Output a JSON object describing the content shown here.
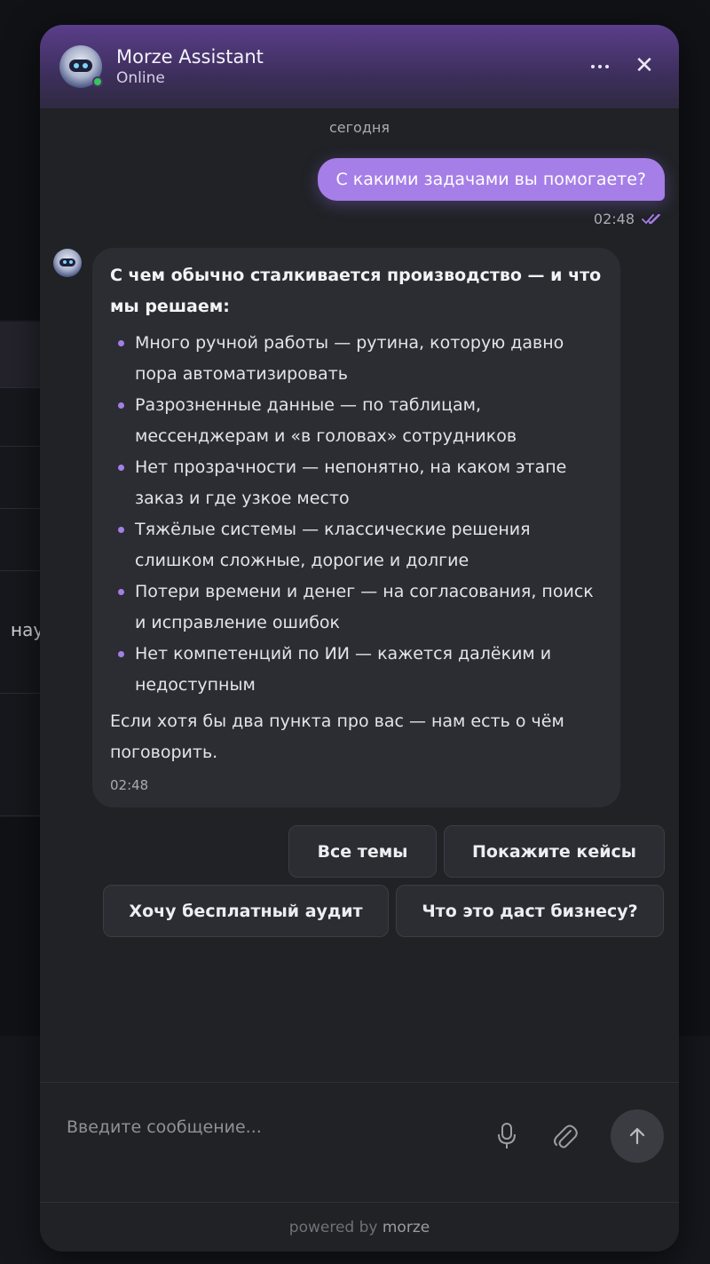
{
  "background": {
    "fragment_text": "нау"
  },
  "header": {
    "title": "Morze Assistant",
    "status": "Online",
    "more_icon": "more-horizontal-icon",
    "close_icon": "close-icon",
    "close_glyph": "✕"
  },
  "chat": {
    "date_separator": "сегодня",
    "user_message": {
      "text": "С какими задачами вы помогаете?",
      "time": "02:48",
      "status_icon": "double-check-icon"
    },
    "bot_message": {
      "heading": "С чем обычно сталкивается производство — и что мы решаем:",
      "items": [
        "Много ручной работы — рутина, которую давно пора автоматизировать",
        "Разрозненные данные — по таблицам, мессенджерам и «в головах» сотрудников",
        "Нет прозрачности — непонятно, на каком этапе заказ и где узкое место",
        "Тяжёлые системы — классические решения слишком сложные, дорогие и долгие",
        "Потери времени и денег — на согласования, поиск и исправление ошибок",
        "Нет компетенций по ИИ — кажется далёким и недоступным"
      ],
      "outro": "Если хотя бы два пункта про вас — нам есть о чём поговорить.",
      "time": "02:48"
    },
    "quick_replies": [
      "Все темы",
      "Покажите кейсы",
      "Хочу бесплатный аудит",
      "Что это даст бизнесу?"
    ]
  },
  "composer": {
    "placeholder": "Введите сообщение...",
    "mic_icon": "microphone-icon",
    "attach_icon": "paperclip-icon",
    "send_icon": "arrow-up-icon"
  },
  "footer": {
    "powered_prefix": "powered by",
    "brand": "morze"
  },
  "colors": {
    "accent": "#a57ee8",
    "header_gradient_top": "#5a3e8a",
    "panel_bg": "#202226",
    "bubble_bg": "#2b2d33",
    "online": "#35c759"
  }
}
